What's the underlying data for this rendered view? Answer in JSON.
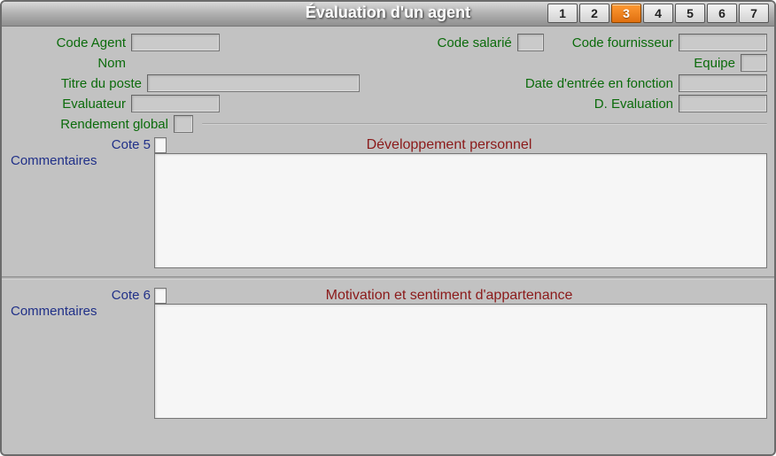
{
  "window": {
    "title": "Évaluation d'un agent"
  },
  "tabs": [
    {
      "label": "1",
      "active": false
    },
    {
      "label": "2",
      "active": false
    },
    {
      "label": "3",
      "active": true
    },
    {
      "label": "4",
      "active": false
    },
    {
      "label": "5",
      "active": false
    },
    {
      "label": "6",
      "active": false
    },
    {
      "label": "7",
      "active": false
    }
  ],
  "form": {
    "code_agent_label": "Code Agent",
    "code_agent_value": "",
    "code_salarie_label": "Code salarié",
    "code_salarie_value": "",
    "code_fournisseur_label": "Code fournisseur",
    "code_fournisseur_value": "",
    "nom_label": "Nom",
    "nom_value": "",
    "equipe_label": "Equipe",
    "equipe_value": "",
    "titre_poste_label": "Titre du poste",
    "titre_poste_value": "",
    "date_entree_label": "Date d'entrée en fonction",
    "date_entree_value": "",
    "evaluateur_label": "Evaluateur",
    "evaluateur_value": "",
    "d_evaluation_label": "D. Evaluation",
    "d_evaluation_value": "",
    "rendement_global_label": "Rendement global",
    "rendement_global_value": ""
  },
  "section1": {
    "cote_label": "Cote 5",
    "cote_value": "",
    "title": "Développement personnel",
    "comments_label": "Commentaires",
    "comments_value": ""
  },
  "section2": {
    "cote_label": "Cote 6",
    "cote_value": "",
    "title": "Motivation et sentiment d'appartenance",
    "comments_label": "Commentaires",
    "comments_value": ""
  }
}
